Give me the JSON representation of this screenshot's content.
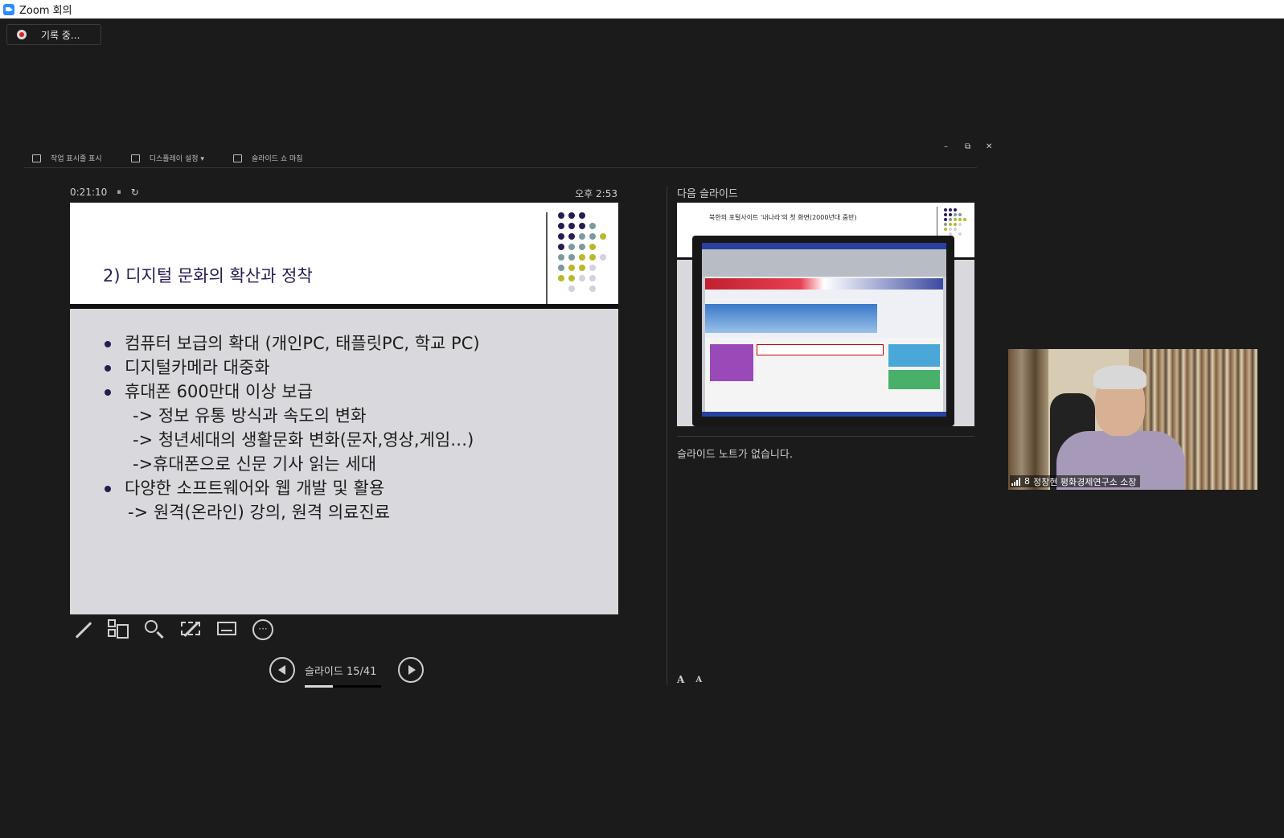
{
  "window": {
    "title": "Zoom 회의"
  },
  "recording": {
    "label": "기록 중..."
  },
  "toolbar": {
    "show_taskbar": "작업 표시줄 표시",
    "display_settings": "디스플레이 설정 ▾",
    "end_slideshow": "슬라이드 쇼 마침"
  },
  "timer": {
    "elapsed": "0:21:10",
    "pause_glyph": "⏸",
    "reset_glyph": "↻",
    "clock": "오후 2:53"
  },
  "slide": {
    "title": "2) 디지털 문화의 확산과 정착",
    "bullets": [
      "컴퓨터 보급의 확대 (개인PC, 태플릿PC, 학교 PC)",
      "디지털카메라 대중화",
      "휴대폰 600만대 이상 보급",
      "-> 정보 유통 방식과 속도의 변화",
      "-> 청년세대의 생활문화 변화(문자,영상,게임…)",
      "->휴대폰으로 신문 기사 읽는 세대",
      "다양한 소프트웨어와 웹 개발 및 활용",
      "-> 원격(온라인) 강의, 원격 의료진료"
    ]
  },
  "nav": {
    "slide_label": "슬라이드 15/41",
    "current": 15,
    "total": 41
  },
  "next": {
    "label": "다음 슬라이드",
    "slide_title": "북한의 포털사이트 '내나라'의 첫 화면(2000년대 중반)",
    "notes": "슬라이드 노트가 없습니다."
  },
  "fonts": {
    "increase": "A",
    "decrease": "A"
  },
  "participant": {
    "count": "8",
    "name": "정창현 평화경제연구소 소장"
  },
  "colors": {
    "accent_purple": "#2a1a54",
    "accent_olive": "#b8b82a",
    "accent_gray": "#7a9aa0",
    "bg": "#1b1b1b"
  }
}
